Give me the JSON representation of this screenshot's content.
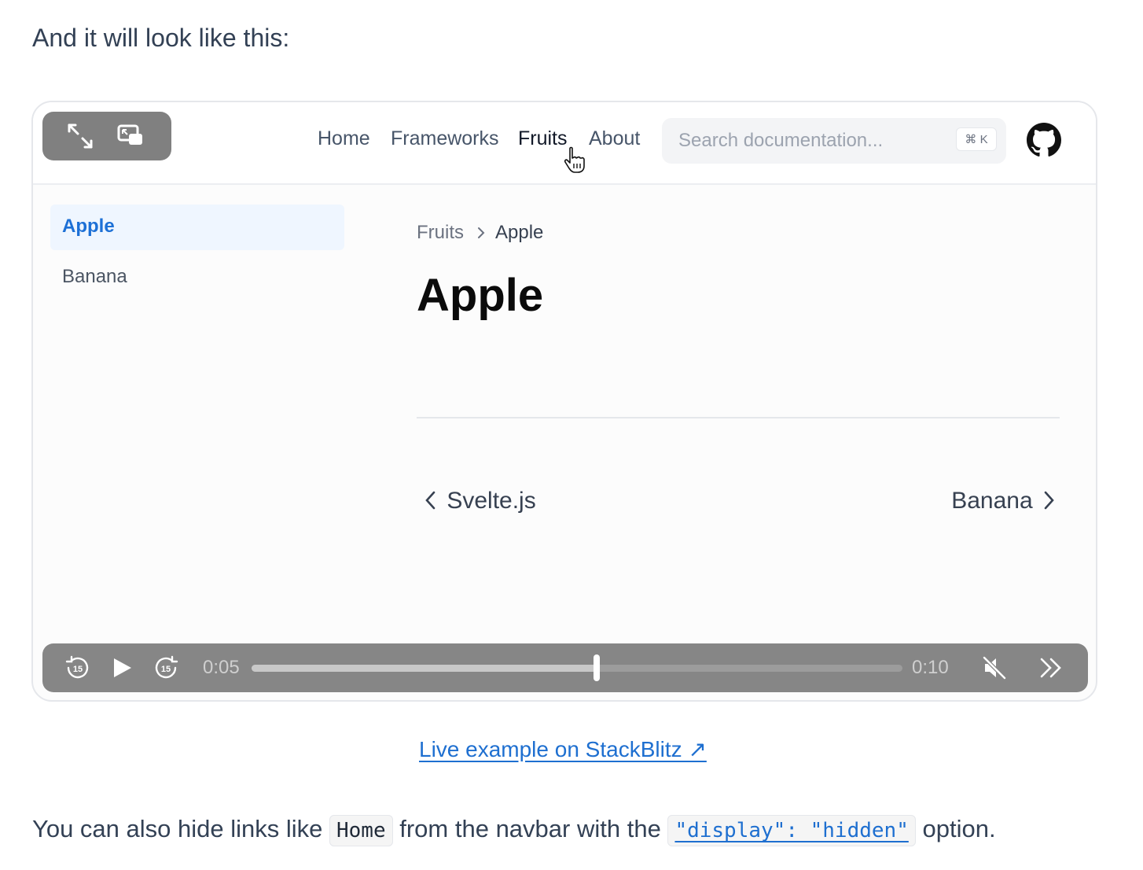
{
  "intro_text": "And it will look like this:",
  "demo": {
    "nav": {
      "links": [
        "Home",
        "Frameworks",
        "Fruits",
        "About"
      ],
      "active_link": "Fruits",
      "search_placeholder": "Search documentation...",
      "search_shortcut": "⌘ K"
    },
    "sidebar": {
      "items": [
        "Apple",
        "Banana"
      ],
      "active_item": "Apple"
    },
    "breadcrumb": [
      "Fruits",
      "Apple"
    ],
    "page_title": "Apple",
    "pagination": {
      "prev": "Svelte.js",
      "next": "Banana"
    }
  },
  "player": {
    "current_time": "0:05",
    "duration": "0:10",
    "progress": 0.53,
    "skip_seconds": "15"
  },
  "live_link": "Live example on StackBlitz ↗",
  "outro": {
    "before": "You can also hide links like",
    "code1": "Home",
    "middle": "from the navbar with the",
    "code2": "\"display\": \"hidden\"",
    "after": "option."
  },
  "colors": {
    "accent": "#1d70d6",
    "sidebar_active_bg": "#eff6ff",
    "player_bg": "#868686"
  }
}
